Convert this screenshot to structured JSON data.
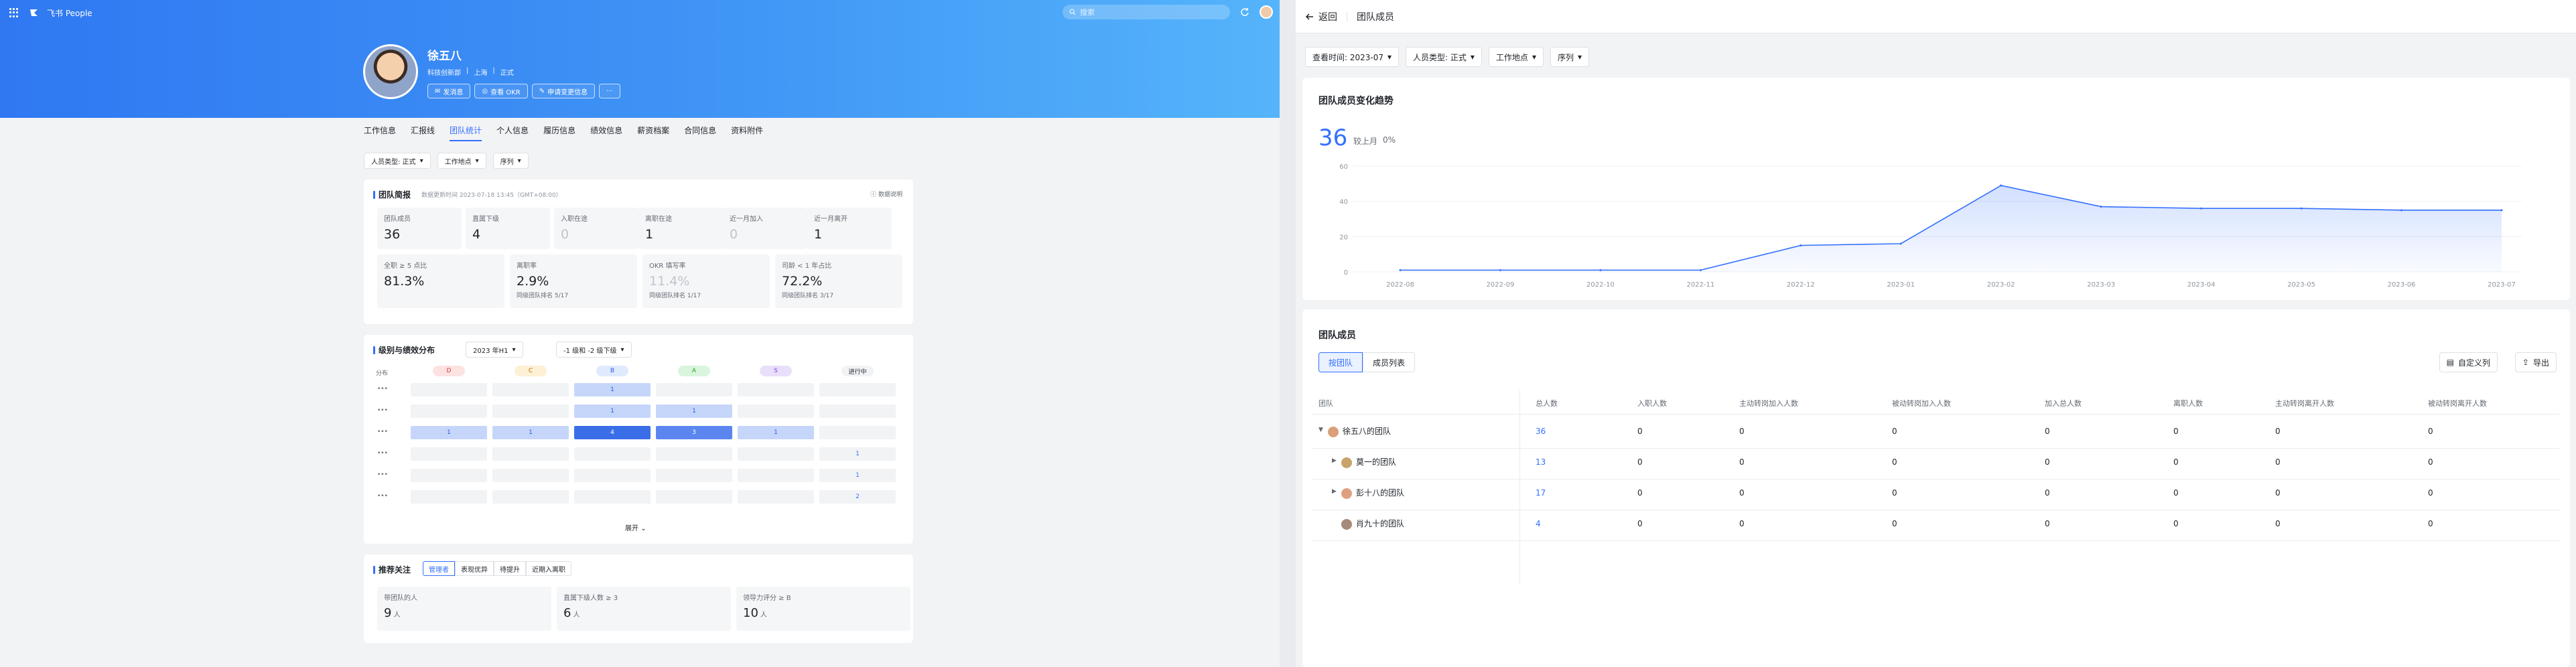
{
  "topbar": {
    "app_name": "飞书 People",
    "search_placeholder": "搜索"
  },
  "profile": {
    "name": "徐五八",
    "dept": "科技创新部",
    "location": "上海",
    "status": "正式",
    "buttons": [
      "发消息",
      "查看 OKR",
      "申请变更信息",
      "···"
    ]
  },
  "tabs": [
    "工作信息",
    "汇报线",
    "团队统计",
    "个人信息",
    "履历信息",
    "绩效信息",
    "薪资档案",
    "合同信息",
    "资料附件"
  ],
  "active_tab": "团队统计",
  "left_filters": [
    "人员类型: 正式",
    "工作地点",
    "序列"
  ],
  "brief": {
    "title": "团队简报",
    "updated": "数据更新时间 2023-07-18 13:45（GMT+08:00）",
    "explain": "数据说明",
    "row1": [
      {
        "label": "团队成员",
        "value": "36"
      },
      {
        "label": "直属下级",
        "value": "4"
      },
      {
        "label": "入职在途",
        "value": "0"
      },
      {
        "label": "离职在途",
        "value": "1"
      },
      {
        "label": "近一月加入",
        "value": "0"
      },
      {
        "label": "近一月离开",
        "value": "1"
      }
    ],
    "row2": [
      {
        "label": "全职 ≥ 5 点比",
        "value": "81.3%",
        "sub": ""
      },
      {
        "label": "离职率",
        "value": "2.9%",
        "sub": "同级团队排名 5/17"
      },
      {
        "label": "OKR 填写率",
        "value": "11.4%",
        "sub": "同级团队排名 1/17"
      },
      {
        "label": "司龄 < 1 年占比",
        "value": "72.2%",
        "sub": "同级团队排名 3/17"
      }
    ]
  },
  "dist": {
    "title": "级别与绩效分布",
    "sel1": "2023 年H1",
    "sel2": "-1 级和 -2 级下级",
    "col_label": "分布",
    "grades": [
      "D",
      "C",
      "B",
      "A",
      "S"
    ],
    "pending": "进行中",
    "row_labels": [
      "•••",
      "•••",
      "•••",
      "•••",
      "•••",
      "•••"
    ],
    "cells": [
      [
        "",
        "",
        "1",
        "",
        "",
        ""
      ],
      [
        "",
        "",
        "1",
        "1",
        "",
        ""
      ],
      [
        "1",
        "1",
        "4",
        "3",
        "1",
        ""
      ],
      [
        "",
        "",
        "",
        "",
        "",
        "1"
      ],
      [
        "",
        "",
        "",
        "",
        "",
        "1"
      ],
      [
        "",
        "",
        "",
        "",
        "",
        "2"
      ]
    ],
    "expand": "展开"
  },
  "focus": {
    "title": "推荐关注",
    "chips": [
      "管理者",
      "表现优异",
      "待提升",
      "近期入离职"
    ],
    "stats": [
      {
        "label": "带团队的人",
        "value": "9",
        "unit": "人"
      },
      {
        "label": "直属下级人数 ≥ 3",
        "value": "6",
        "unit": "人"
      },
      {
        "label": "领导力评分 ≥ B",
        "value": "10",
        "unit": "人"
      }
    ]
  },
  "right": {
    "back": "返回",
    "title": "团队成员",
    "filters": [
      "查看时间: 2023-07",
      "人员类型: 正式",
      "工作地点",
      "序列"
    ],
    "trend": {
      "title": "团队成员变化趋势",
      "total": "36",
      "compare": "较上月",
      "compare_value": "0%"
    },
    "members": {
      "title": "团队成员",
      "view_tabs": [
        "按团队",
        "成员列表"
      ],
      "custom_col": "自定义列",
      "export": "导出",
      "headers": [
        "团队",
        "总人数",
        "入职人数",
        "主动转岗加入人数",
        "被动转岗加入人数",
        "加入总人数",
        "离职人数",
        "主动转岗离开人数",
        "被动转岗离开人数"
      ],
      "rows": [
        {
          "team": "徐五八的团队",
          "level": 0,
          "exp": "down",
          "vals": [
            "36",
            "0",
            "0",
            "0",
            "0",
            "0",
            "0",
            "0"
          ]
        },
        {
          "team": "莫一的团队",
          "level": 1,
          "exp": "right",
          "vals": [
            "13",
            "0",
            "0",
            "0",
            "0",
            "0",
            "0",
            "0"
          ]
        },
        {
          "team": "彭十八的团队",
          "level": 1,
          "exp": "right",
          "vals": [
            "17",
            "0",
            "0",
            "0",
            "0",
            "0",
            "0",
            "0"
          ]
        },
        {
          "team": "肖九十的团队",
          "level": 1,
          "exp": "",
          "vals": [
            "4",
            "0",
            "0",
            "0",
            "0",
            "0",
            "0",
            "0"
          ]
        }
      ]
    }
  },
  "chart_data": {
    "type": "area",
    "x": [
      "2022-08",
      "2022-09",
      "2022-10",
      "2022-11",
      "2022-12",
      "2023-01",
      "2023-02",
      "2023-03",
      "2023-04",
      "2023-05",
      "2023-06",
      "2023-07"
    ],
    "values": [
      1,
      1,
      1,
      1,
      15,
      16,
      49,
      37,
      36,
      36,
      35,
      35
    ],
    "ylim": [
      0,
      60
    ],
    "yticks": [
      0,
      20,
      40,
      60
    ],
    "grid": true,
    "color": "#3370ff"
  }
}
